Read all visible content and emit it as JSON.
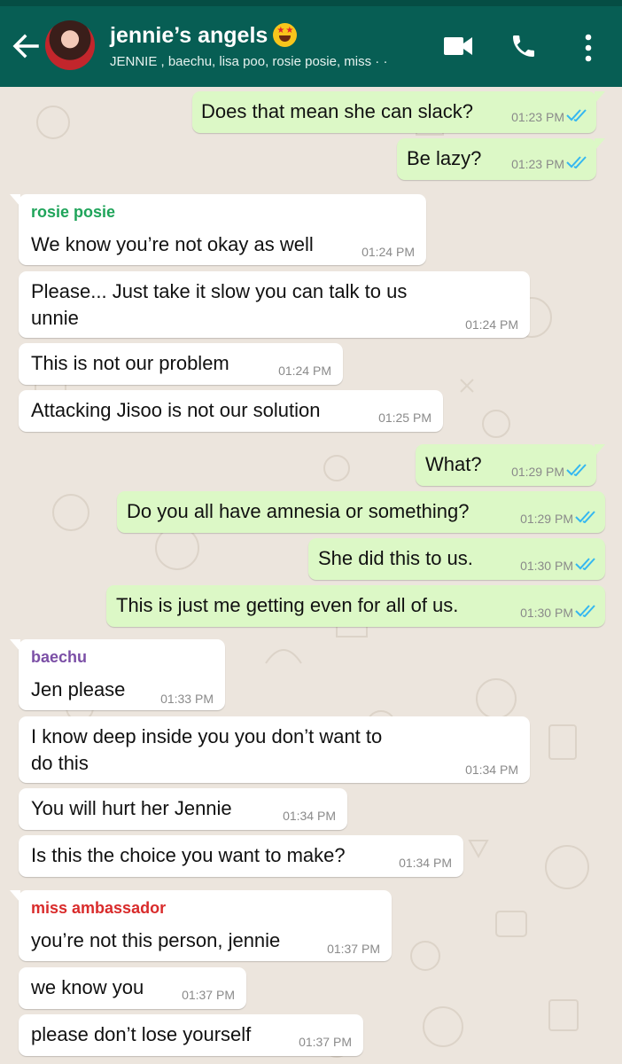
{
  "header": {
    "title": "jennie’s angels",
    "title_emoji": "star-struck-emoji",
    "subtitle": "JENNIE , baechu, lisa poo, rosie posie, miss ·  ·",
    "icons": [
      "back-arrow-icon",
      "group-avatar",
      "video-call-icon",
      "phone-call-icon",
      "more-options-icon"
    ]
  },
  "colors": {
    "header": "#075e54",
    "status_bar": "#054d44",
    "chat_background": "#ece5dd",
    "outgoing_bubble": "#dcf8c6",
    "incoming_bubble": "#ffffff",
    "read_ticks": "#34b7f1",
    "rosie_posie": "#1fa45a",
    "baechu": "#7b4fa6",
    "miss_ambassador": "#d92b2b"
  },
  "messages": [
    {
      "dir": "out",
      "text": "Does that mean she can slack?",
      "time": "01:23 PM",
      "ticks": "read"
    },
    {
      "dir": "out",
      "text": "Be lazy?",
      "time": "01:23 PM",
      "ticks": "read"
    },
    {
      "dir": "in",
      "sender": "rosie posie",
      "text": "We know you’re not okay as well",
      "time": "01:24 PM"
    },
    {
      "dir": "in",
      "text": "Please... Just take it slow you can talk to us",
      "text2": "unnie",
      "time": "01:24 PM"
    },
    {
      "dir": "in",
      "text": "This is not our problem",
      "time": "01:24 PM"
    },
    {
      "dir": "in",
      "text": "Attacking Jisoo is not our solution",
      "time": "01:25 PM"
    },
    {
      "dir": "out",
      "text": "What?",
      "time": "01:29 PM",
      "ticks": "read"
    },
    {
      "dir": "out",
      "text": "Do you all have amnesia or something?",
      "time": "01:29 PM",
      "ticks": "read"
    },
    {
      "dir": "out",
      "text": "She did this to us.",
      "time": "01:30 PM",
      "ticks": "read"
    },
    {
      "dir": "out",
      "text": "This is just me getting even for all of us.",
      "time": "01:30 PM",
      "ticks": "read"
    },
    {
      "dir": "in",
      "sender": "baechu",
      "text": "Jen please",
      "time": "01:33 PM"
    },
    {
      "dir": "in",
      "text": "I know deep inside you you don’t want to",
      "text2": "do this",
      "time": "01:34 PM"
    },
    {
      "dir": "in",
      "text": "You will hurt her Jennie",
      "time": "01:34 PM"
    },
    {
      "dir": "in",
      "text": "Is this the choice you want to make?",
      "time": "01:34 PM"
    },
    {
      "dir": "in",
      "sender": "miss ambassador",
      "text": "you’re not this person, jennie",
      "time": "01:37 PM"
    },
    {
      "dir": "in",
      "text": "we know you",
      "time": "01:37 PM"
    },
    {
      "dir": "in",
      "text": "please don’t lose yourself",
      "time": "01:37 PM"
    }
  ]
}
